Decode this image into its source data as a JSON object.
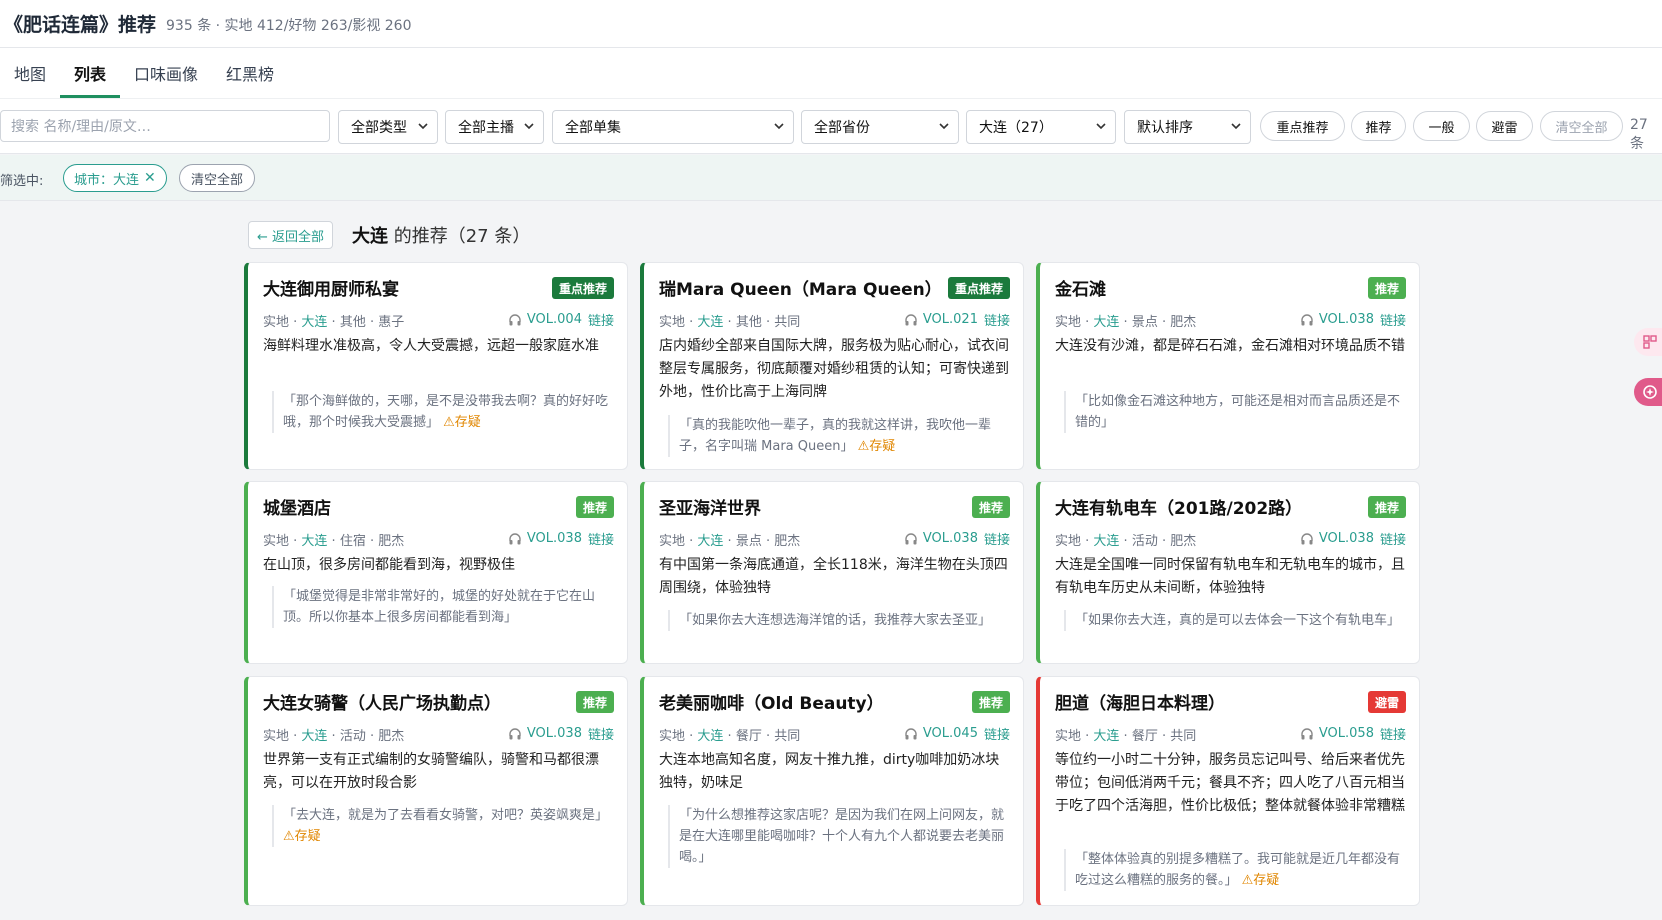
{
  "header": {
    "title": "《肥话连篇》推荐",
    "stats": "935 条 · 实地 412/好物 263/影视 260"
  },
  "tabs": [
    {
      "label": "地图"
    },
    {
      "label": "列表"
    },
    {
      "label": "口味画像"
    },
    {
      "label": "红黑榜"
    }
  ],
  "filters": {
    "search_placeholder": "搜索 名称/理由/原文…",
    "type": "全部类型",
    "host": "全部主播",
    "episode": "全部单集",
    "province": "全部省份",
    "city": "大连（27）",
    "sort": "默认排序",
    "level_buttons": [
      "重点推荐",
      "推荐",
      "一般",
      "避雷"
    ],
    "clear_all": "清空全部",
    "count": "27 条"
  },
  "active_filters": {
    "label": "筛选中:",
    "city_chip": "城市：大连",
    "clear": "清空全部"
  },
  "section": {
    "back": "← 返回全部",
    "city": "大连",
    "suffix": " 的推荐（27 条）"
  },
  "link_label": "链接",
  "doubt_label": "⚠存疑",
  "cards": [
    {
      "title": "大连御用厨师私宴",
      "badge": "重点推荐",
      "level": "major",
      "meta_pre": "实地 · ",
      "city": "大连",
      "meta_post": " · 其他 · 惠子",
      "vol": "VOL.004",
      "reason": "海鲜料理水准极高，令人大受震撼，远超一般家庭水准",
      "quote": "「那个海鲜做的，天哪，是不是没带我去啊？真的好好吃哦，那个时候我大受震撼」",
      "doubt": true
    },
    {
      "title": "瑞Mara Queen（Mara Queen）",
      "badge": "重点推荐",
      "level": "major",
      "meta_pre": "实地 · ",
      "city": "大连",
      "meta_post": " · 其他 · 共同",
      "vol": "VOL.021",
      "reason": "店内婚纱全部来自国际大牌，服务极为贴心耐心，试衣间整层专属服务，彻底颠覆对婚纱租赁的认知；可寄快递到外地，性价比高于上海同牌",
      "quote": "「真的我能吹他一辈子，真的我就这样讲，我吹他一辈子，名字叫瑞 Mara Queen」",
      "doubt": true
    },
    {
      "title": "金石滩",
      "badge": "推荐",
      "level": "rec",
      "meta_pre": "实地 · ",
      "city": "大连",
      "meta_post": " · 景点 · 肥杰",
      "vol": "VOL.038",
      "reason": "大连没有沙滩，都是碎石石滩，金石滩相对环境品质不错",
      "quote": "「比如像金石滩这种地方，可能还是相对而言品质还是不错的」",
      "doubt": false
    },
    {
      "title": "城堡酒店",
      "badge": "推荐",
      "level": "rec",
      "meta_pre": "实地 · ",
      "city": "大连",
      "meta_post": " · 住宿 · 肥杰",
      "vol": "VOL.038",
      "reason": "在山顶，很多房间都能看到海，视野极佳",
      "quote": "「城堡觉得是非常非常好的，城堡的好处就在于它在山顶。所以你基本上很多房间都能看到海」",
      "doubt": false
    },
    {
      "title": "圣亚海洋世界",
      "badge": "推荐",
      "level": "rec",
      "meta_pre": "实地 · ",
      "city": "大连",
      "meta_post": " · 景点 · 肥杰",
      "vol": "VOL.038",
      "reason": "有中国第一条海底通道，全长118米，海洋生物在头顶四周围绕，体验独特",
      "quote": "「如果你去大连想选海洋馆的话，我推荐大家去圣亚」",
      "doubt": false
    },
    {
      "title": "大连有轨电车（201路/202路）",
      "badge": "推荐",
      "level": "rec",
      "meta_pre": "实地 · ",
      "city": "大连",
      "meta_post": " · 活动 · 肥杰",
      "vol": "VOL.038",
      "reason": "大连是全国唯一同时保留有轨电车和无轨电车的城市，且有轨电车历史从未间断，体验独特",
      "quote": "「如果你去大连，真的是可以去体会一下这个有轨电车」",
      "doubt": false
    },
    {
      "title": "大连女骑警（人民广场执勤点）",
      "badge": "推荐",
      "level": "rec",
      "meta_pre": "实地 · ",
      "city": "大连",
      "meta_post": " · 活动 · 肥杰",
      "vol": "VOL.038",
      "reason": "世界第一支有正式编制的女骑警编队，骑警和马都很漂亮，可以在开放时段合影",
      "quote": "「去大连，就是为了去看看女骑警，对吧？英姿飒爽是」",
      "doubt": true
    },
    {
      "title": "老美丽咖啡（Old Beauty）",
      "badge": "推荐",
      "level": "rec",
      "meta_pre": "实地 · ",
      "city": "大连",
      "meta_post": " · 餐厅 · 共同",
      "vol": "VOL.045",
      "reason": "大连本地高知名度，网友十推九推，dirty咖啡加奶冰块独特，奶味足",
      "quote": "「为什么想推荐这家店呢？是因为我们在网上问网友，就是在大连哪里能喝咖啡？十个人有九个人都说要去老美丽喝。」",
      "doubt": false
    },
    {
      "title": "胆道（海胆日本料理）",
      "badge": "避雷",
      "level": "avoid",
      "meta_pre": "实地 · ",
      "city": "大连",
      "meta_post": " · 餐厅 · 共同",
      "vol": "VOL.058",
      "reason": "等位约一小时二十分钟，服务员忘记叫号、给后来者优先带位；包间低消两千元；餐具不齐；四人吃了八百元相当于吃了四个活海胆，性价比极低；整体就餐体验非常糟糕",
      "quote": "「整体体验真的别提多糟糕了。我可能就是近几年都没有吃过这么糟糕的服务的餐。」",
      "doubt": true
    }
  ]
}
